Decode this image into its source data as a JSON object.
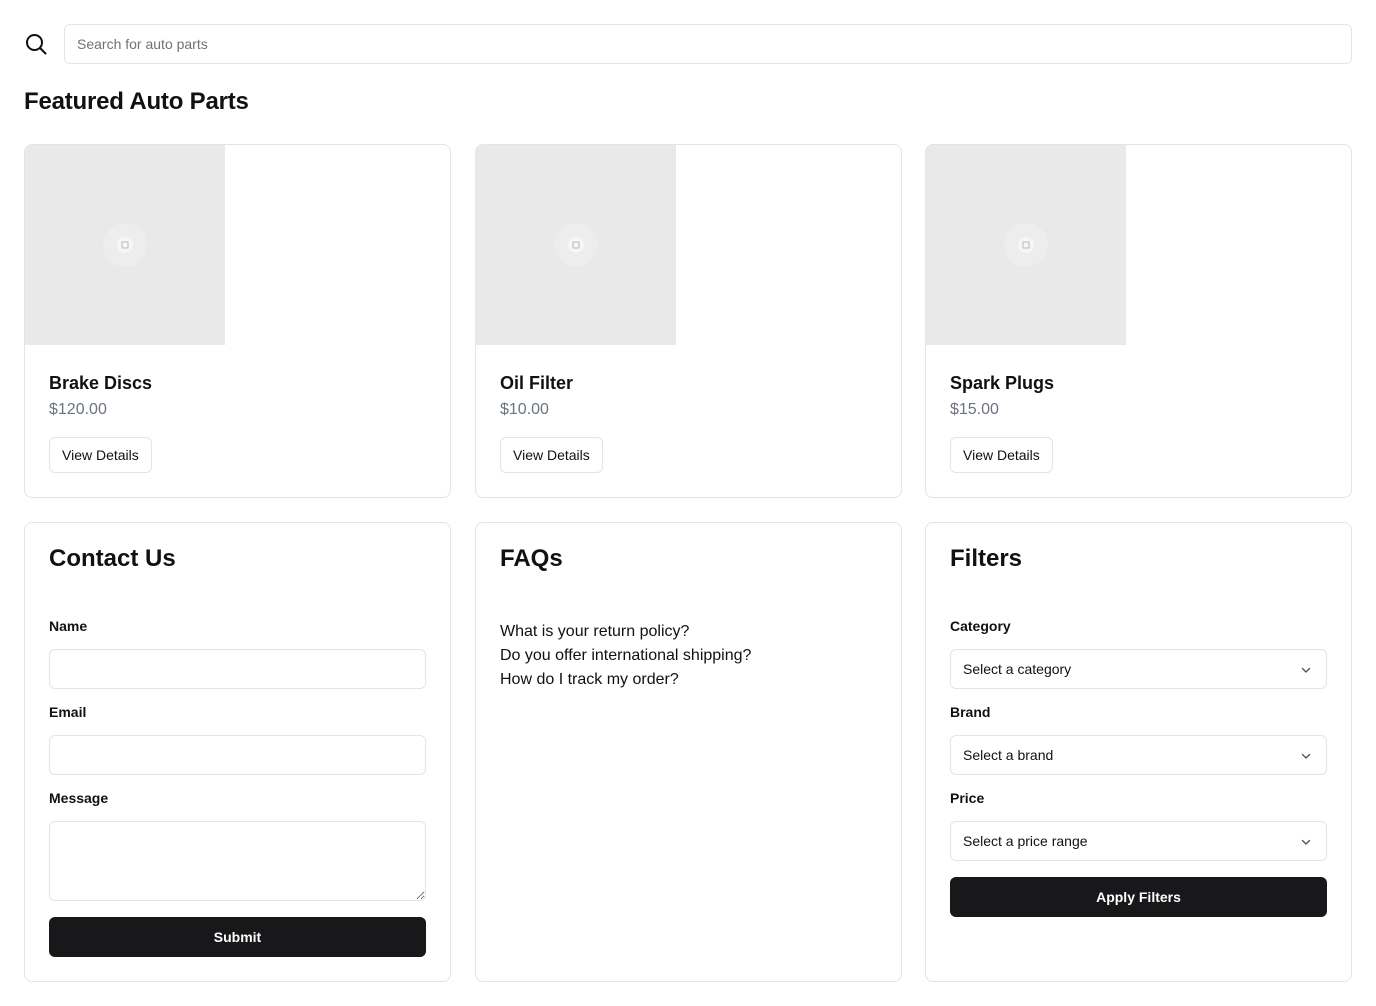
{
  "search": {
    "placeholder": "Search for auto parts"
  },
  "featured": {
    "title": "Featured Auto Parts",
    "products": [
      {
        "name": "Brake Discs",
        "price": "$120.00",
        "button": "View Details"
      },
      {
        "name": "Oil Filter",
        "price": "$10.00",
        "button": "View Details"
      },
      {
        "name": "Spark Plugs",
        "price": "$15.00",
        "button": "View Details"
      }
    ]
  },
  "contact": {
    "title": "Contact Us",
    "name_label": "Name",
    "email_label": "Email",
    "message_label": "Message",
    "submit": "Submit"
  },
  "faqs": {
    "title": "FAQs",
    "items": [
      "What is your return policy?",
      "Do you offer international shipping?",
      "How do I track my order?"
    ]
  },
  "filters": {
    "title": "Filters",
    "category_label": "Category",
    "category_value": "Select a category",
    "brand_label": "Brand",
    "brand_value": "Select a brand",
    "price_label": "Price",
    "price_value": "Select a price range",
    "apply": "Apply Filters"
  },
  "icons": {
    "search": "search-icon",
    "image_placeholder": "image-placeholder-icon",
    "chevron": "chevron-down-icon"
  }
}
